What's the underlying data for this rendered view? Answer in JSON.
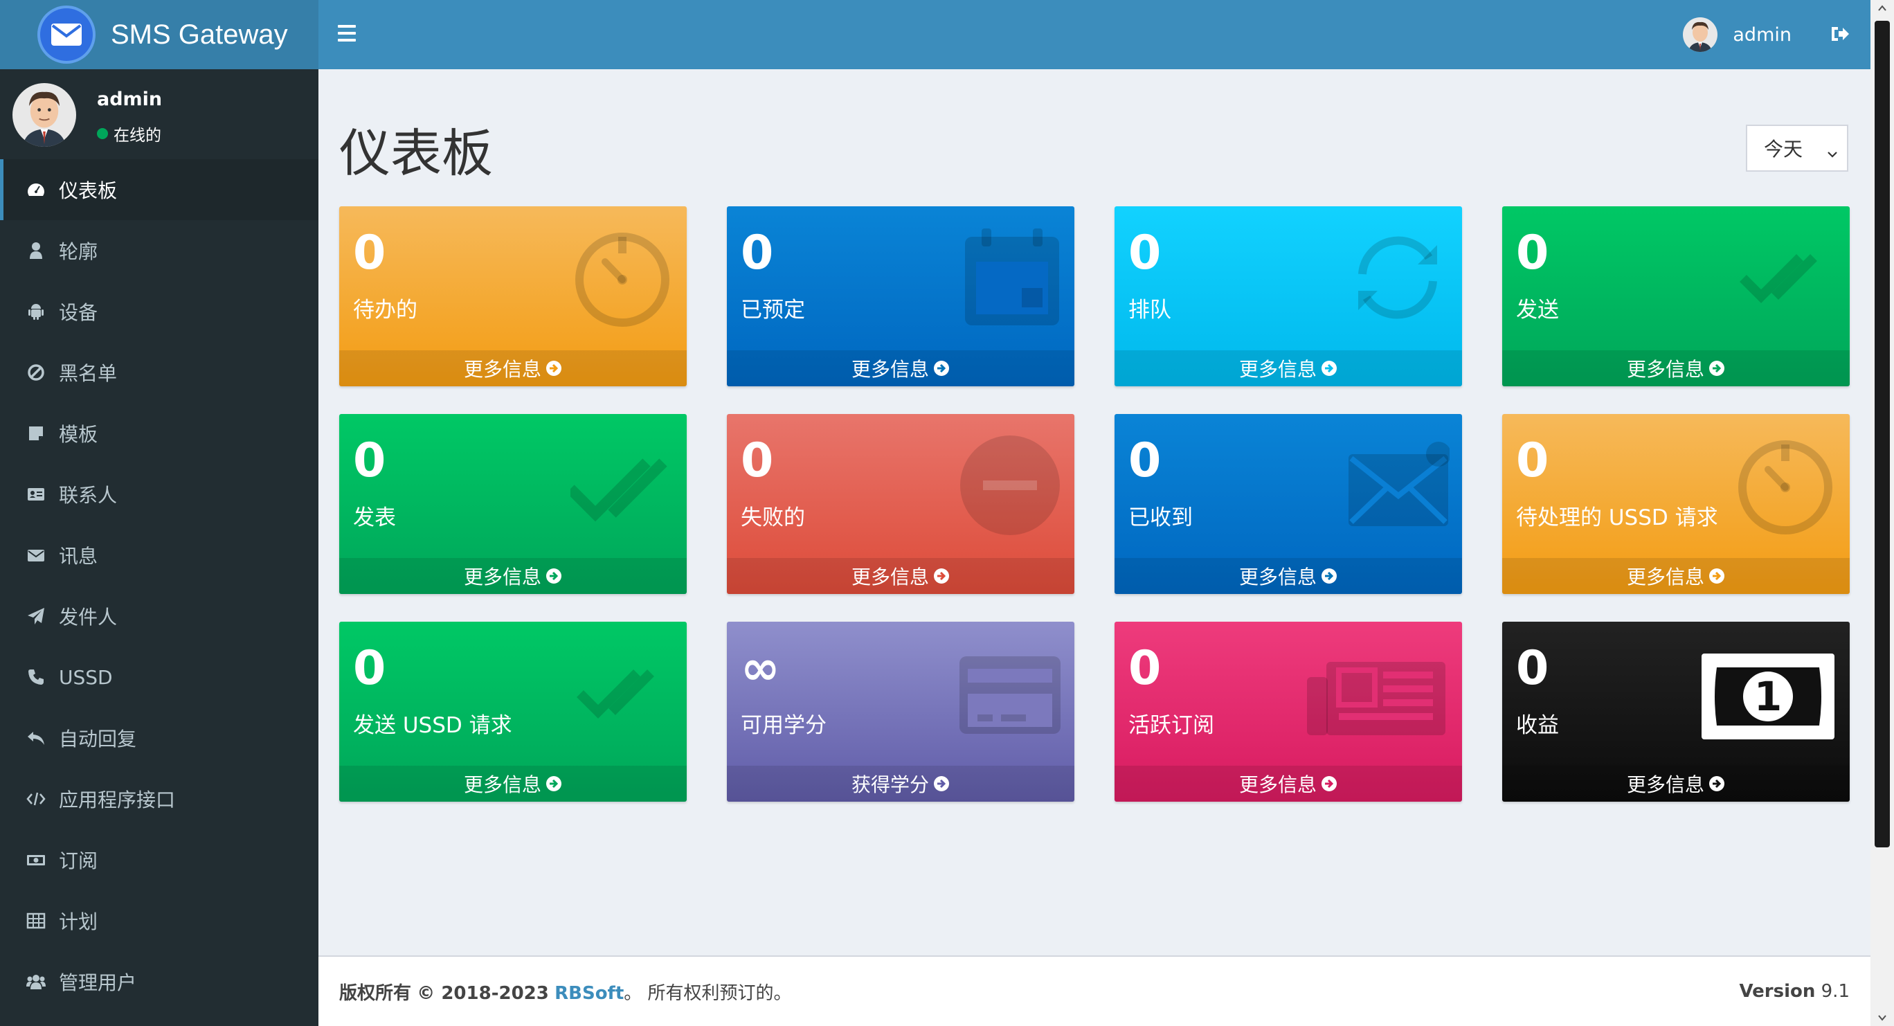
{
  "app": {
    "logo_text": "SMS Gateway"
  },
  "header": {
    "user_name": "admin"
  },
  "sidebar": {
    "user_name": "admin",
    "status": "在线的",
    "items": [
      {
        "label": "仪表板",
        "icon": "dashboard-icon"
      },
      {
        "label": "轮廓",
        "icon": "user-icon"
      },
      {
        "label": "设备",
        "icon": "android-icon"
      },
      {
        "label": "黑名单",
        "icon": "ban-icon"
      },
      {
        "label": "模板",
        "icon": "template-icon"
      },
      {
        "label": "联系人",
        "icon": "address-card-icon"
      },
      {
        "label": "讯息",
        "icon": "envelope-icon"
      },
      {
        "label": "发件人",
        "icon": "paper-plane-icon"
      },
      {
        "label": "USSD",
        "icon": "phone-icon"
      },
      {
        "label": "自动回复",
        "icon": "reply-all-icon"
      },
      {
        "label": "应用程序接口",
        "icon": "code-icon"
      },
      {
        "label": "订阅",
        "icon": "money-icon"
      },
      {
        "label": "计划",
        "icon": "table-icon"
      },
      {
        "label": "管理用户",
        "icon": "users-icon"
      }
    ]
  },
  "main": {
    "title": "仪表板",
    "range_select": "今天",
    "boxes": [
      {
        "value": "0",
        "label": "待办的",
        "footer": "更多信息",
        "icon": "stopwatch-icon",
        "color": "#f39c12"
      },
      {
        "value": "0",
        "label": "已预定",
        "footer": "更多信息",
        "icon": "calendar-icon",
        "color": "#0073b7"
      },
      {
        "value": "0",
        "label": "排队",
        "footer": "更多信息",
        "icon": "sync-icon",
        "color": "#00c0ef"
      },
      {
        "value": "0",
        "label": "发送",
        "footer": "更多信息",
        "icon": "check-double-icon",
        "color": "#00a65a"
      },
      {
        "value": "0",
        "label": "发表",
        "footer": "更多信息",
        "icon": "check-double-icon",
        "color": "#00a65a"
      },
      {
        "value": "0",
        "label": "失败的",
        "footer": "更多信息",
        "icon": "minus-circle-icon",
        "color": "#dd4b39"
      },
      {
        "value": "0",
        "label": "已收到",
        "footer": "更多信息",
        "icon": "envelope-icon",
        "color": "#0073b7"
      },
      {
        "value": "0",
        "label": "待处理的 USSD 请求",
        "footer": "更多信息",
        "icon": "stopwatch-icon",
        "color": "#f39c12"
      },
      {
        "value": "0",
        "label": "发送 USSD 请求",
        "footer": "更多信息",
        "icon": "check-double-icon",
        "color": "#00a65a"
      },
      {
        "value": "∞",
        "label": "可用学分",
        "footer": "获得学分",
        "icon": "credit-card-icon",
        "color": "#605ca8"
      },
      {
        "value": "0",
        "label": "活跃订阅",
        "footer": "更多信息",
        "icon": "newspaper-icon",
        "color": "#d81b60"
      },
      {
        "value": "0",
        "label": "收益",
        "footer": "更多信息",
        "icon": "money-bill-icon",
        "color": "#111111"
      }
    ]
  },
  "footer": {
    "copyright_prefix": "版权所有",
    "copyright_years": "© 2018-2023",
    "brand": "RBSoft",
    "rights": "。 所有权利预订的。",
    "version_label": "Version",
    "version_number": "9.1"
  }
}
